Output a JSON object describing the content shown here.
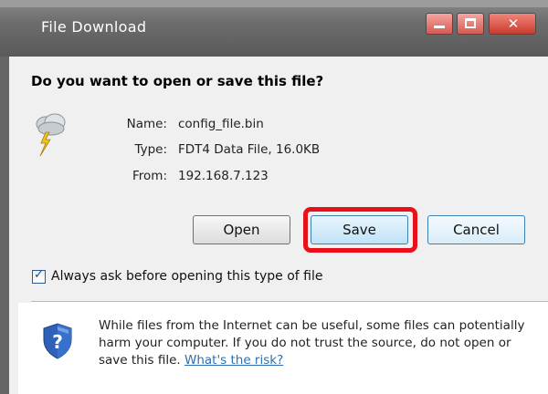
{
  "window": {
    "title": "File Download"
  },
  "dialog": {
    "question": "Do you want to open or save this file?",
    "file": {
      "name_label": "Name:",
      "name": "config_file.bin",
      "type_label": "Type:",
      "type": "FDT4 Data File, 16.0KB",
      "from_label": "From:",
      "from": "192.168.7.123",
      "icon": "weather-storm-file-icon"
    },
    "buttons": {
      "open": "Open",
      "save": "Save",
      "cancel": "Cancel"
    },
    "highlight_color": "#e8101b",
    "always_ask": {
      "label": "Always ask before opening this type of file",
      "checked": true
    },
    "warning": {
      "text": "While files from the Internet can be useful, some files can potentially harm your computer. If you do not trust the source, do not open or save this file.",
      "link": "What's the risk?",
      "icon": "shield-question-icon"
    }
  }
}
